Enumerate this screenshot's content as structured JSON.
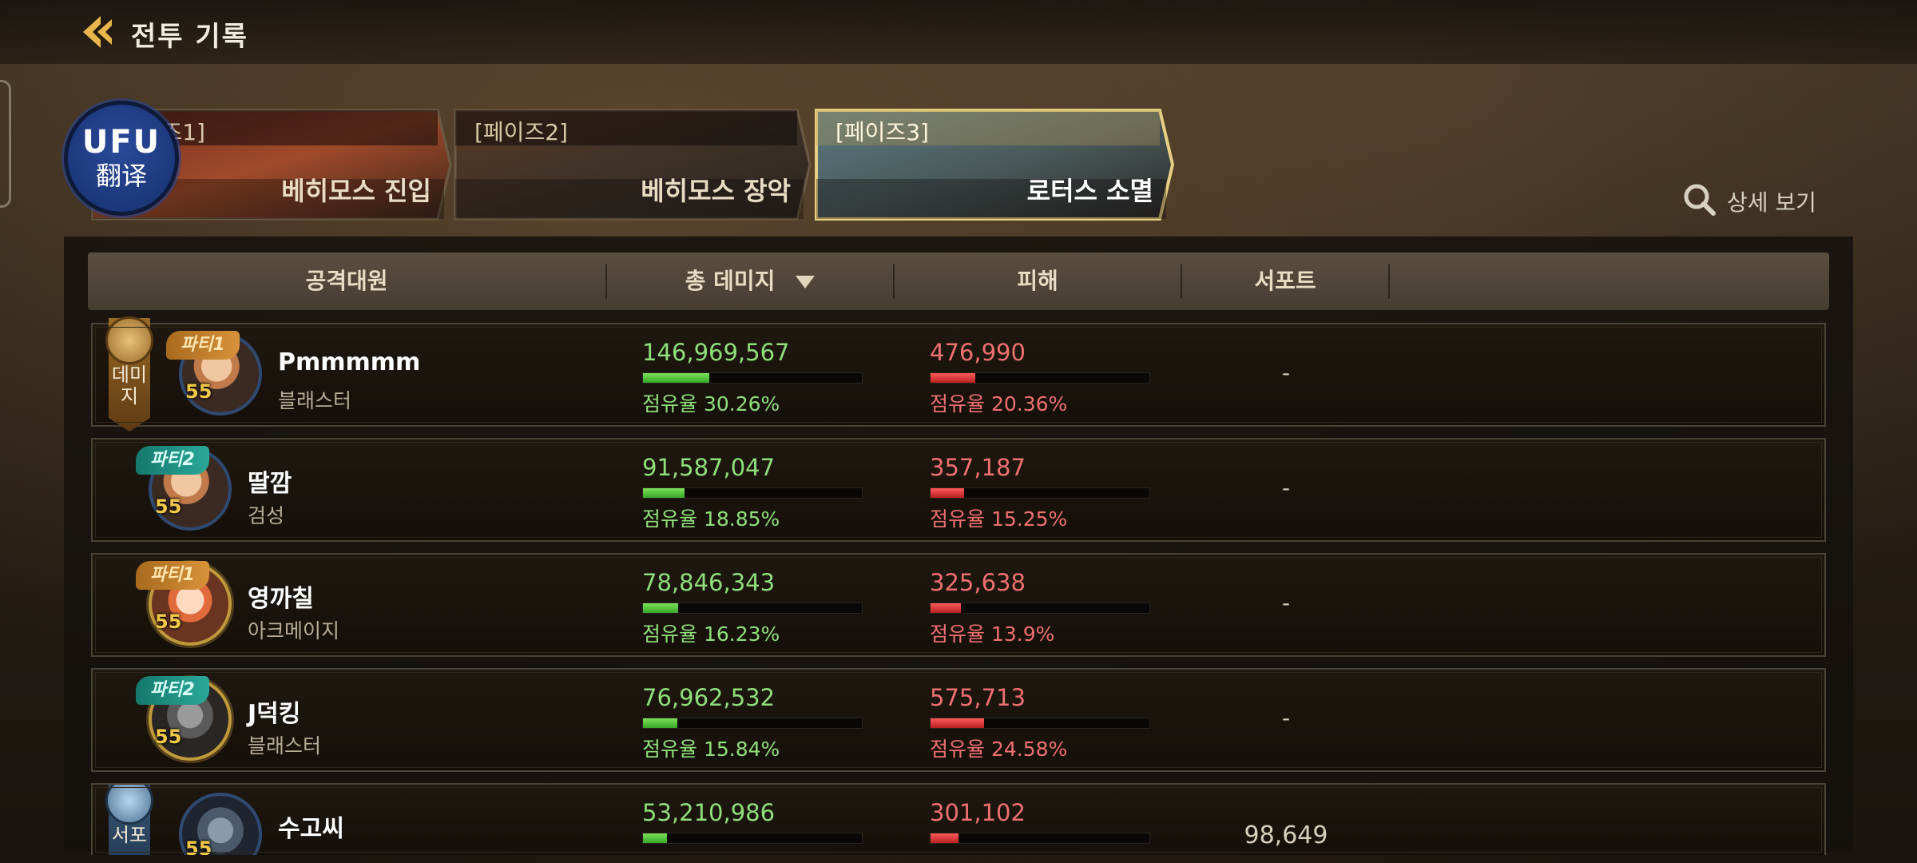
{
  "header": {
    "title": "전투 기록"
  },
  "phases": [
    {
      "label": "[페이즈1]",
      "name": "베히모스 진입",
      "active": false
    },
    {
      "label": "[페이즈2]",
      "name": "베히모스 장악",
      "active": false
    },
    {
      "label": "[페이즈3]",
      "name": "로터스 소멸",
      "active": true
    }
  ],
  "translate": {
    "logo": "UFU",
    "text": "翻译"
  },
  "detail_link": "상세 보기",
  "table": {
    "columns": [
      "공격대원",
      "총 데미지",
      "피해",
      "서포트"
    ],
    "rows": [
      {
        "role": "데미지",
        "party": "파티1",
        "level": "55",
        "name": "Pmmmmm",
        "class": "블래스터",
        "damage": "146,969,567",
        "damage_share": "점유율 30.26%",
        "damage_share_value": 30.26,
        "taken": "476,990",
        "taken_share": "점유율 20.36%",
        "taken_share_value": 20.36,
        "support": "-"
      },
      {
        "role": "",
        "party": "파티2",
        "level": "55",
        "name": "딸깜",
        "class": "검성",
        "damage": "91,587,047",
        "damage_share": "점유율 18.85%",
        "damage_share_value": 18.85,
        "taken": "357,187",
        "taken_share": "점유율 15.25%",
        "taken_share_value": 15.25,
        "support": "-"
      },
      {
        "role": "",
        "party": "파티1",
        "level": "55",
        "name": "영까칠",
        "class": "아크메이지",
        "damage": "78,846,343",
        "damage_share": "점유율 16.23%",
        "damage_share_value": 16.23,
        "taken": "325,638",
        "taken_share": "점유율 13.9%",
        "taken_share_value": 13.9,
        "support": "-"
      },
      {
        "role": "",
        "party": "파티2",
        "level": "55",
        "name": "J덕킹",
        "class": "블래스터",
        "damage": "76,962,532",
        "damage_share": "점유율 15.84%",
        "damage_share_value": 15.84,
        "taken": "575,713",
        "taken_share": "점유율 24.58%",
        "taken_share_value": 24.58,
        "support": "-"
      },
      {
        "role": "서포",
        "party": "",
        "level": "55",
        "name": "수고씨",
        "class": "",
        "damage": "53,210,986",
        "damage_share": "",
        "damage_share_value": 10.95,
        "taken": "301,102",
        "taken_share": "",
        "taken_share_value": 12.62,
        "support": "98,649"
      }
    ]
  },
  "colors": {
    "damage": "#8fe07a",
    "taken": "#f07070",
    "party1": "#d8923a",
    "party2": "#2aa89a",
    "active_tab": "#e6cf82"
  },
  "icons": {
    "back": "back-arrow-icon",
    "search": "search-icon",
    "damage_role": "fist-icon",
    "support_role": "wing-icon"
  }
}
